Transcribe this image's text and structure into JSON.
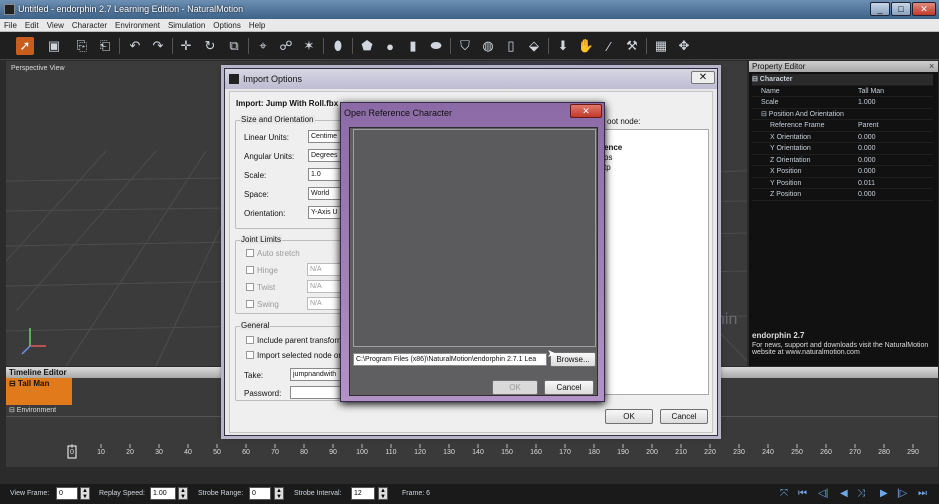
{
  "window": {
    "title": "Untitled - endorphin 2.7 Learning Edition - NaturalMotion",
    "min": "_",
    "max": "□",
    "close": "✕"
  },
  "menu": [
    "File",
    "Edit",
    "View",
    "Character",
    "Environment",
    "Simulation",
    "Options",
    "Help"
  ],
  "toolbar_icons": [
    "select-icon",
    "save-icon",
    "import-icon",
    "export-icon",
    "undo-icon",
    "redo-icon",
    "move-icon",
    "rotate-icon",
    "scale-icon",
    "joint-icon",
    "pose-icon",
    "character-icon",
    "body-icon",
    "box-icon",
    "sphere-icon",
    "cylinder-icon",
    "capsule-icon",
    "shield-icon",
    "globe-icon",
    "column-icon",
    "cube-icon",
    "arrow-down-icon",
    "hand-icon",
    "brush-icon",
    "effector-icon",
    "camera-icon",
    "network-icon"
  ],
  "viewport": {
    "label": "Perspective View",
    "watermark": "nin"
  },
  "property_editor": {
    "title": "Property Editor",
    "rows": [
      {
        "key": "⊟ Character",
        "value": "",
        "indent": 0,
        "bold": true
      },
      {
        "key": "Name",
        "value": "Tall Man",
        "indent": 1
      },
      {
        "key": "Scale",
        "value": "1.000",
        "indent": 1
      },
      {
        "key": "⊟ Position And Orientation",
        "value": "",
        "indent": 1
      },
      {
        "key": "Reference Frame",
        "value": "Parent",
        "indent": 2
      },
      {
        "key": "X Orientation",
        "value": "0.000",
        "indent": 2
      },
      {
        "key": "Y Orientation",
        "value": "0.000",
        "indent": 2
      },
      {
        "key": "Z Orientation",
        "value": "0.000",
        "indent": 2
      },
      {
        "key": "X Position",
        "value": "0.000",
        "indent": 2
      },
      {
        "key": "Y Position",
        "value": "0.011",
        "indent": 2
      },
      {
        "key": "Z Position",
        "value": "0.000",
        "indent": 2
      }
    ],
    "info_title": "endorphin 2.7",
    "info_text": "For news, support and downloads visit the NaturalMotion website at www.naturalmotion.com"
  },
  "timeline": {
    "title": "Timeline Editor",
    "character": "⊟ Tall Man",
    "environment": "⊟ Environment",
    "ticks": [
      "0",
      "10",
      "20",
      "30",
      "40",
      "50",
      "60",
      "70",
      "80",
      "90",
      "100",
      "110",
      "120",
      "130",
      "140",
      "150",
      "160",
      "170",
      "180",
      "190",
      "200",
      "210",
      "220",
      "230",
      "240",
      "250",
      "260",
      "270",
      "280",
      "290"
    ]
  },
  "statusbar": {
    "view_frame_label": "View Frame:",
    "view_frame": "0",
    "replay_speed_label": "Replay Speed:",
    "replay_speed": "1.00",
    "strobe_range_label": "Strobe Range:",
    "strobe_range": "0",
    "strobe_interval_label": "Strobe Interval:",
    "strobe_interval": "12",
    "frame": "Frame: 6"
  },
  "import_dialog": {
    "title": "Import Options",
    "header": "Import: Jump With Roll.fbx",
    "size_group": "Size and Orientation",
    "linear_units_label": "Linear Units:",
    "linear_units": "Centime",
    "angular_units_label": "Angular Units:",
    "angular_units": "Degrees",
    "scale_label": "Scale:",
    "scale": "1.0",
    "space_label": "Space:",
    "space": "World",
    "orientation_label": "Orientation:",
    "orientation": "Y-Axis U",
    "joint_group": "Joint Limits",
    "auto_stretch": "Auto stretch",
    "hinge": "Hinge",
    "hinge_val": "N/A",
    "twist": "Twist",
    "twist_val": "N/A",
    "swing": "Swing",
    "swing_val": "N/A",
    "general_group": "General",
    "include_parent": "Include parent transform",
    "import_selected": "Import selected node onl",
    "take_label": "Take:",
    "take": "jumpnandwith",
    "password_label": "Password:",
    "password": "",
    "root_node_label": "oot node:",
    "tree_items": [
      "ence",
      "ps",
      "tp"
    ],
    "ok": "OK",
    "cancel": "Cancel"
  },
  "ref_dialog": {
    "title": "Open Reference Character",
    "close": "✕",
    "path": "C:\\Program Files (x86)\\NaturalMotion\\endorphin 2.7.1 Lea",
    "browse": "Browse...",
    "ok": "OK",
    "cancel": "Cancel"
  }
}
